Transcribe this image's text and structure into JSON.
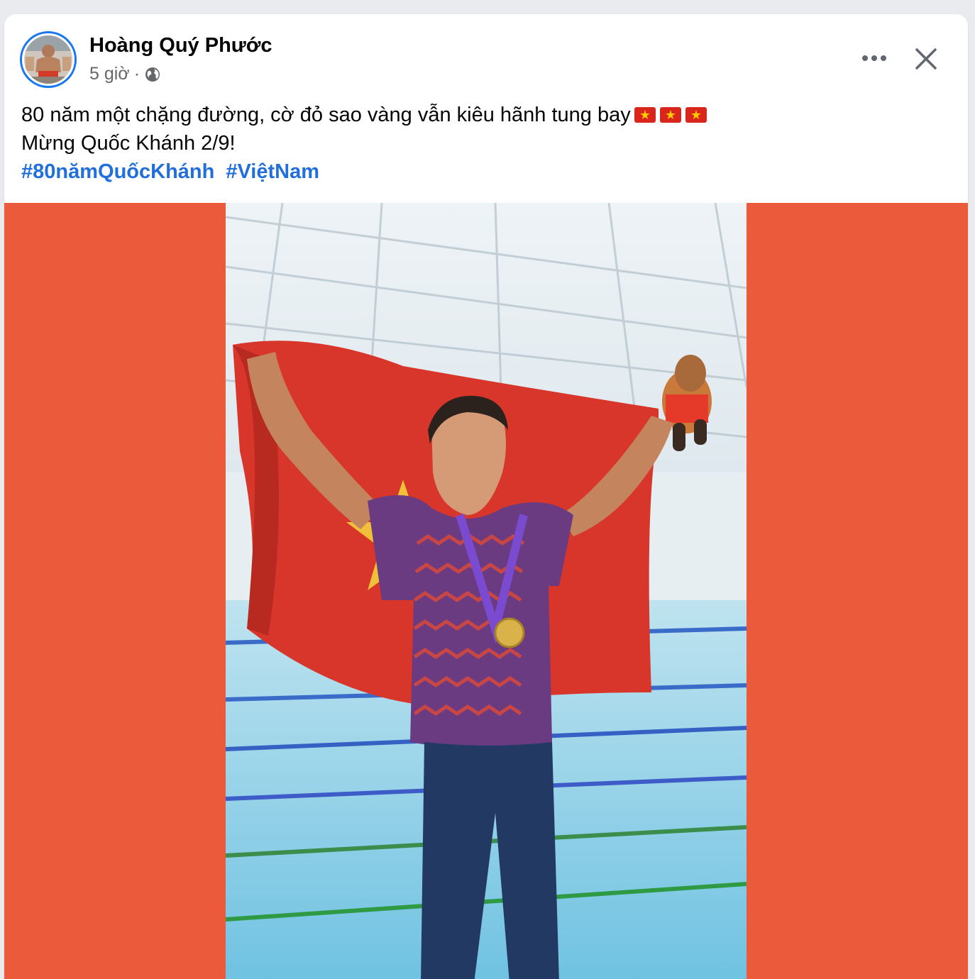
{
  "post": {
    "author_name": "Hoàng Quý Phước",
    "timestamp": "5 giờ",
    "separator": "·",
    "privacy_icon": "globe-icon",
    "line1": "80 năm một chặng đường, cờ đỏ sao vàng vẫn kiêu hãnh tung bay",
    "line1_emoji": [
      "flag-vietnam-emoji",
      "flag-vietnam-emoji",
      "flag-vietnam-emoji"
    ],
    "line2": "Mừng Quốc Khánh 2/9!",
    "hashtags": [
      "#80nămQuốcKhánh",
      "#ViệtNam"
    ]
  },
  "actions": {
    "more_icon": "more-horizontal-icon",
    "close_icon": "close-icon"
  },
  "colors": {
    "media_background": "#ea5a3b",
    "hashtag": "#216fdb",
    "avatar_ring": "#1877f2",
    "flag_red": "#da251d",
    "flag_star": "#ffcd00"
  }
}
